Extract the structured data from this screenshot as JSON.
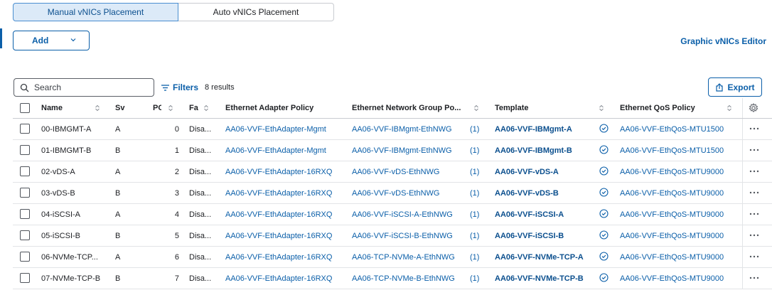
{
  "tabs": {
    "manual": "Manual vNICs Placement",
    "auto": "Auto vNICs Placement"
  },
  "add_label": "Add",
  "graphic_editor_label": "Graphic vNICs Editor",
  "search": {
    "placeholder": "Search"
  },
  "filters_label": "Filters",
  "results_label": "8 results",
  "export_label": "Export",
  "columns": {
    "name": "Name",
    "switch": "Sv",
    "pci": "PC",
    "failover": "Fa",
    "adapter": "Ethernet Adapter Policy",
    "network": "Ethernet Network Group Po...",
    "template": "Template",
    "qos": "Ethernet QoS Policy"
  },
  "rows": [
    {
      "name": "00-IBMGMT-A",
      "switch": "A",
      "pci": "0",
      "failover": "Disa...",
      "adapter": "AA06-VVF-EthAdapter-Mgmt",
      "network": "AA06-VVF-IBMgmt-EthNWG",
      "network_count": "(1)",
      "template": "AA06-VVF-IBMgmt-A",
      "qos": "AA06-VVF-EthQoS-MTU1500"
    },
    {
      "name": "01-IBMGMT-B",
      "switch": "B",
      "pci": "1",
      "failover": "Disa...",
      "adapter": "AA06-VVF-EthAdapter-Mgmt",
      "network": "AA06-VVF-IBMgmt-EthNWG",
      "network_count": "(1)",
      "template": "AA06-VVF-IBMgmt-B",
      "qos": "AA06-VVF-EthQoS-MTU1500"
    },
    {
      "name": "02-vDS-A",
      "switch": "A",
      "pci": "2",
      "failover": "Disa...",
      "adapter": "AA06-VVF-EthAdapter-16RXQ",
      "network": "AA06-VVF-vDS-EthNWG",
      "network_count": "(1)",
      "template": "AA06-VVF-vDS-A",
      "qos": "AA06-VVF-EthQoS-MTU9000"
    },
    {
      "name": "03-vDS-B",
      "switch": "B",
      "pci": "3",
      "failover": "Disa...",
      "adapter": "AA06-VVF-EthAdapter-16RXQ",
      "network": "AA06-VVF-vDS-EthNWG",
      "network_count": "(1)",
      "template": "AA06-VVF-vDS-B",
      "qos": "AA06-VVF-EthQoS-MTU9000"
    },
    {
      "name": "04-iSCSI-A",
      "switch": "A",
      "pci": "4",
      "failover": "Disa...",
      "adapter": "AA06-VVF-EthAdapter-16RXQ",
      "network": "AA06-VVF-iSCSI-A-EthNWG",
      "network_count": "(1)",
      "template": "AA06-VVF-iSCSI-A",
      "qos": "AA06-VVF-EthQoS-MTU9000"
    },
    {
      "name": "05-iSCSI-B",
      "switch": "B",
      "pci": "5",
      "failover": "Disa...",
      "adapter": "AA06-VVF-EthAdapter-16RXQ",
      "network": "AA06-VVF-iSCSI-B-EthNWG",
      "network_count": "(1)",
      "template": "AA06-VVF-iSCSI-B",
      "qos": "AA06-VVF-EthQoS-MTU9000"
    },
    {
      "name": "06-NVMe-TCP...",
      "switch": "A",
      "pci": "6",
      "failover": "Disa...",
      "adapter": "AA06-VVF-EthAdapter-16RXQ",
      "network": "AA06-TCP-NVMe-A-EthNWG",
      "network_count": "(1)",
      "template": "AA06-VVF-NVMe-TCP-A",
      "qos": "AA06-VVF-EthQoS-MTU9000"
    },
    {
      "name": "07-NVMe-TCP-B",
      "switch": "B",
      "pci": "7",
      "failover": "Disa...",
      "adapter": "AA06-VVF-EthAdapter-16RXQ",
      "network": "AA06-TCP-NVMe-B-EthNWG",
      "network_count": "(1)",
      "template": "AA06-VVF-NVMe-TCP-B",
      "qos": "AA06-VVF-EthQoS-MTU9000"
    }
  ],
  "icons": {
    "search": "search-icon",
    "filter": "filter-icon",
    "export": "export-icon",
    "sort": "sort-icon",
    "check": "check-circle-icon",
    "more": "more-horizontal-icon",
    "settings": "gear-icon"
  },
  "colors": {
    "accent": "#0b5fa9",
    "active_tab_bg": "#dceaf8"
  }
}
